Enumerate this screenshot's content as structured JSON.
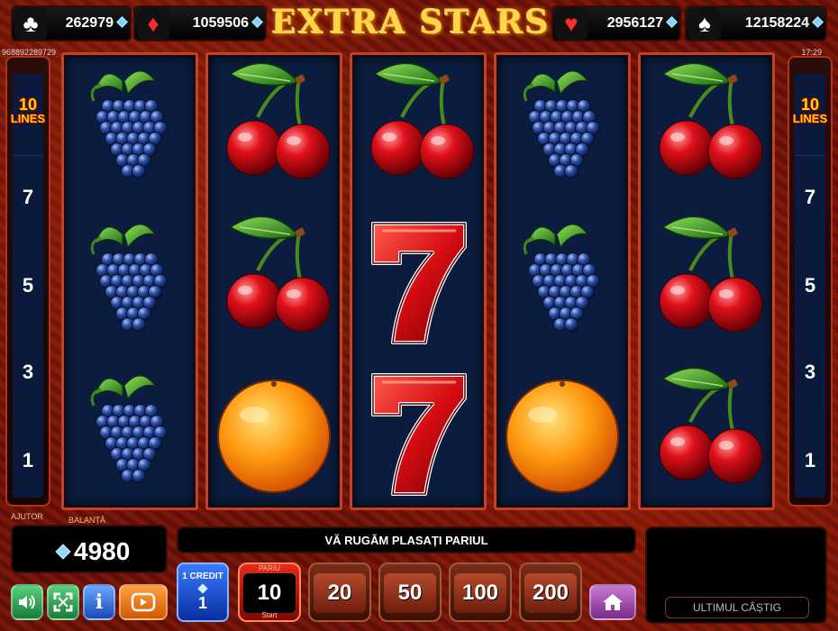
{
  "title": "EXTRA  STARS",
  "jackpots": [
    {
      "suit": "clubs",
      "glyph": "♣",
      "value": "262979",
      "color": "#ffffff"
    },
    {
      "suit": "diamonds",
      "glyph": "♦",
      "value": "1059506",
      "color": "#ff2b2b"
    },
    {
      "suit": "hearts",
      "glyph": "♥",
      "value": "2956127",
      "color": "#ff2b2b"
    },
    {
      "suit": "spades",
      "glyph": "♠",
      "value": "12158224",
      "color": "#ffffff"
    }
  ],
  "session_id": "968892289729",
  "clock": "17:29",
  "lines_badge": {
    "count": "10",
    "label": "LINES"
  },
  "line_numbers_left": [
    "7",
    "5",
    "3",
    "1"
  ],
  "line_numbers_right": [
    "7",
    "5",
    "3",
    "1"
  ],
  "reels": [
    [
      "grapes-icon",
      "grapes-icon",
      "grapes-icon"
    ],
    [
      "cherries-icon",
      "cherries-icon",
      "orange-icon"
    ],
    [
      "cherries-icon",
      "seven-icon",
      "seven-icon"
    ],
    [
      "grapes-icon",
      "grapes-icon",
      "orange-icon"
    ],
    [
      "cherries-icon",
      "cherries-icon",
      "cherries-icon"
    ]
  ],
  "help_label": "AJUTOR",
  "balance": {
    "label": "BALANȚĂ",
    "value": "4980"
  },
  "message": "VĂ RUGĂM PLASAȚI PARIUL",
  "credit": {
    "label": "1 CREDIT",
    "value": "1"
  },
  "bets": [
    {
      "value": "10",
      "caption": "PARIU",
      "sub": "Start",
      "active": true
    },
    {
      "value": "20",
      "caption": "",
      "sub": "",
      "active": false
    },
    {
      "value": "50",
      "caption": "",
      "sub": "",
      "active": false
    },
    {
      "value": "100",
      "caption": "",
      "sub": "",
      "active": false
    },
    {
      "value": "200",
      "caption": "",
      "sub": "",
      "active": false
    }
  ],
  "last_win_label": "ULTIMUL CÂȘTIG",
  "buttons": {
    "sound": "speaker-icon",
    "fullscreen": "fullscreen-icon",
    "info": "i",
    "autoplay": "autoplay-icon",
    "home": "home-icon"
  }
}
